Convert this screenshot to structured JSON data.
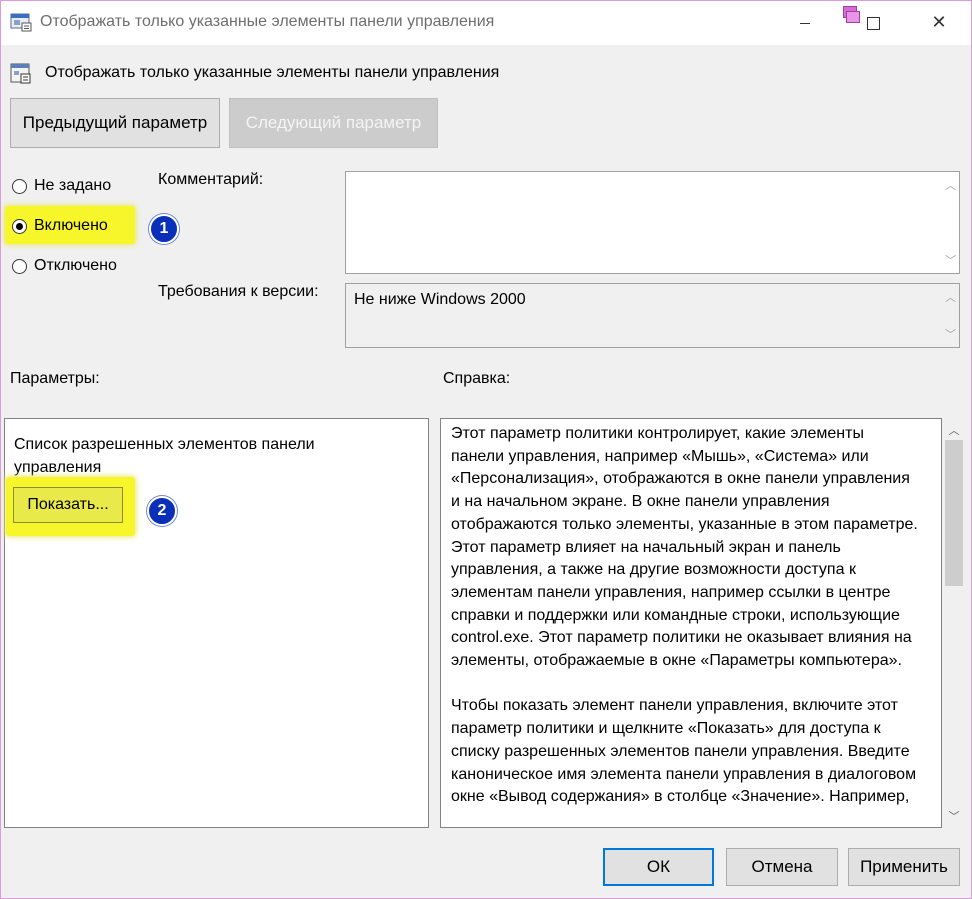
{
  "window": {
    "title": "Отображать только указанные элементы панели управления",
    "minimize_icon": "minimize-icon",
    "maximize_icon": "maximize-icon",
    "close_icon": "close-icon",
    "close_glyph": "✕"
  },
  "policy": {
    "heading": "Отображать только указанные элементы панели управления",
    "icon": "policy-settings-icon"
  },
  "nav": {
    "prev_label": "Предыдущий параметр",
    "next_label": "Следующий параметр"
  },
  "state": {
    "options": [
      {
        "label": "Не задано",
        "checked": false
      },
      {
        "label": "Включено",
        "checked": true
      },
      {
        "label": "Отключено",
        "checked": false
      }
    ]
  },
  "comment": {
    "label": "Комментарий:",
    "value": ""
  },
  "requirements": {
    "label": "Требования к версии:",
    "value": "Не ниже Windows 2000"
  },
  "params": {
    "label": "Параметры:",
    "list_label": "Список разрешенных элементов панели управления",
    "show_button": "Показать..."
  },
  "help": {
    "label": "Справка:",
    "text": "Этот параметр политики контролирует, какие элементы\nпанели управления, например «Мышь», «Система» или\n«Персонализация», отображаются в окне панели управления\nи на начальном экране. В окне панели управления\nотображаются только элементы, указанные в этом параметре.\nЭтот параметр влияет на начальный экран и панель\nуправления, а также на другие возможности доступа к\nэлементам панели управления, например ссылки в центре\nсправки и поддержки или командные строки, использующие\ncontrol.exe. Этот параметр политики не оказывает влияния на\nэлементы, отображаемые в окне «Параметры компьютера».\n\nЧтобы показать элемент панели управления, включите этот\nпараметр политики и щелкните «Показать» для доступа к\nсписку разрешенных элементов панели управления. Введите\nканоническое имя элемента панели управления в диалоговом\nокне «Вывод содержания» в столбце «Значение». Например,"
  },
  "annotations": {
    "badge1": "1",
    "badge2": "2",
    "highlight_color": "#f6f62a",
    "badge_color": "#0a2fb8"
  },
  "footer": {
    "ok_label": "ОК",
    "cancel_label": "Отмена",
    "apply_label": "Применить"
  }
}
